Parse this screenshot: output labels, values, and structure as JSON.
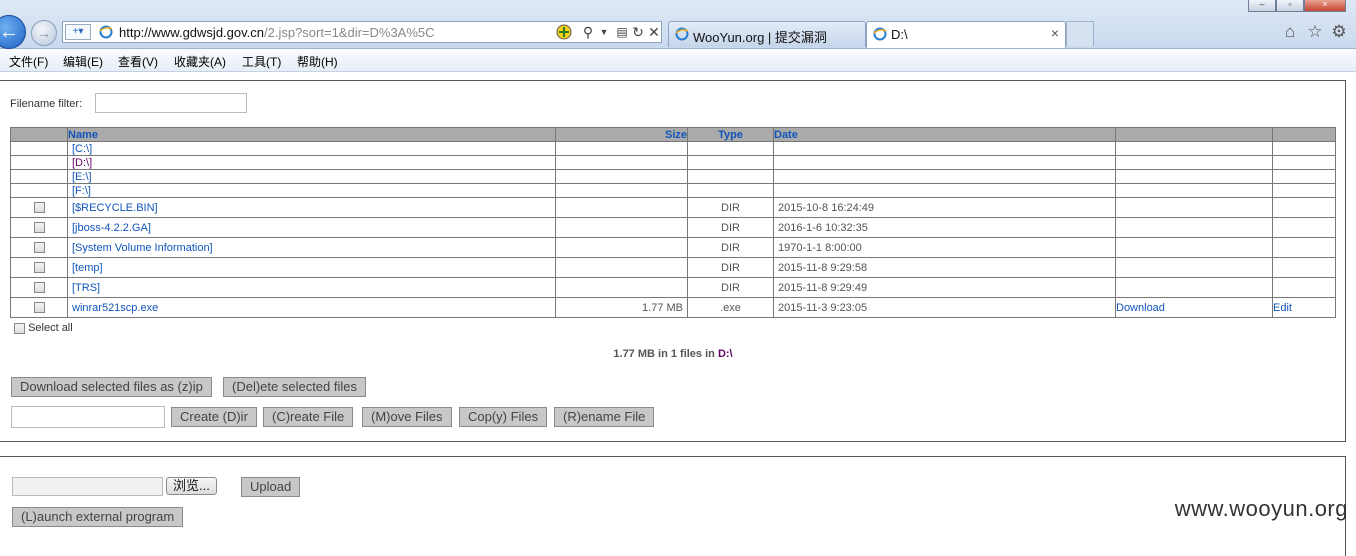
{
  "browser": {
    "url_host": "http://www.gdwsjd.gov.cn",
    "url_path": "/2.jsp?sort=1&dir=D%3A%5C",
    "tabs": [
      {
        "label": "WooYun.org | 提交漏洞"
      },
      {
        "label": "D:\\"
      }
    ],
    "tab_close": "×"
  },
  "menu": [
    "文件(F)",
    "编辑(E)",
    "查看(V)",
    "收藏夹(A)",
    "工具(T)",
    "帮助(H)"
  ],
  "filter": {
    "label": "Filename filter:",
    "value": ""
  },
  "table": {
    "headers": {
      "name": "Name",
      "size": "Size",
      "type": "Type",
      "date": "Date"
    },
    "drives": [
      "[C:\\]",
      "[D:\\]",
      "[E:\\]",
      "[F:\\]"
    ],
    "active_drive_color": "#660066",
    "rows": [
      {
        "name": "[$RECYCLE.BIN]",
        "size": "",
        "type": "DIR",
        "date": "2015-10-8 16:24:49",
        "download": "",
        "edit": ""
      },
      {
        "name": "[jboss-4.2.2.GA]",
        "size": "",
        "type": "DIR",
        "date": "2016-1-6 10:32:35",
        "download": "",
        "edit": ""
      },
      {
        "name": "[System Volume Information]",
        "size": "",
        "type": "DIR",
        "date": "1970-1-1 8:00:00",
        "download": "",
        "edit": ""
      },
      {
        "name": "[temp]",
        "size": "",
        "type": "DIR",
        "date": "2015-11-8 9:29:58",
        "download": "",
        "edit": ""
      },
      {
        "name": "[TRS]",
        "size": "",
        "type": "DIR",
        "date": "2015-11-8 9:29:49",
        "download": "",
        "edit": ""
      },
      {
        "name": "winrar521scp.exe",
        "size": "1.77 MB",
        "type": ".exe",
        "date": "2015-11-3 9:23:05",
        "download": "Download",
        "edit": "Edit"
      }
    ]
  },
  "select_all": "Select all",
  "summary": {
    "text": "1.77 MB in 1 files in ",
    "dir": "D:\\"
  },
  "actions": {
    "download_zip": "Download selected files as (z)ip",
    "delete": "(Del)ete selected files",
    "create_dir": "Create (D)ir",
    "create_file": "(C)reate File",
    "move": "(M)ove Files",
    "copy": "Cop(y) Files",
    "rename": "(R)ename File"
  },
  "upload": {
    "browse": "浏览...",
    "upload": "Upload",
    "launch": "(L)aunch external program"
  },
  "watermark": "www.wooyun.org"
}
